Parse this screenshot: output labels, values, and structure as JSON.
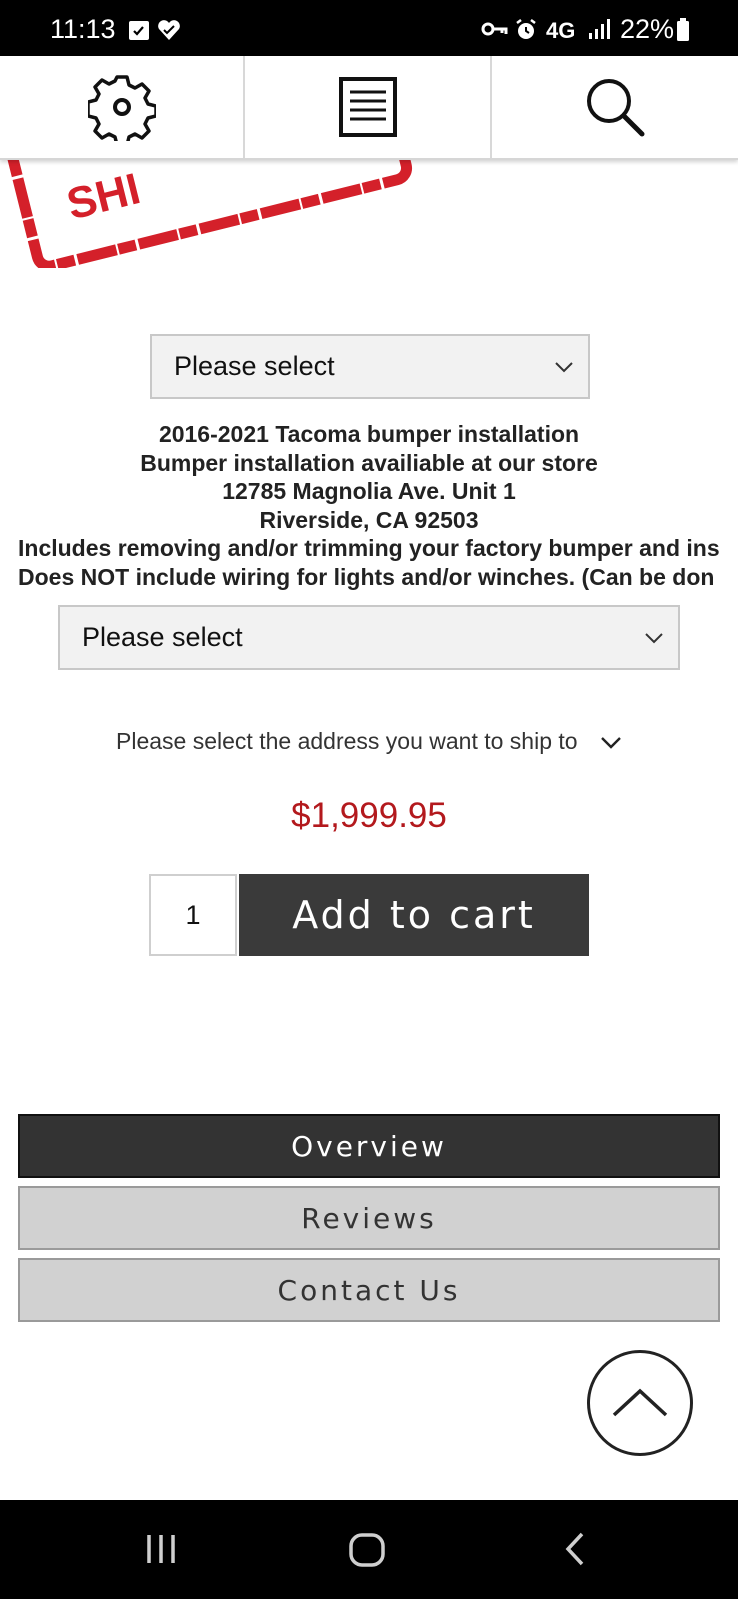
{
  "status_bar": {
    "time": "11:13",
    "network": "4G",
    "battery": "22%"
  },
  "top_nav": {
    "settings_icon": "gear-icon",
    "menu_icon": "document-list-icon",
    "search_icon": "search-icon"
  },
  "stamp": {
    "text": "SHI"
  },
  "option_select_1": {
    "value": "Please select"
  },
  "description": {
    "line1": "2016-2021 Tacoma bumper installation",
    "line2": "Bumper installation availiable at our store",
    "line3": "12785 Magnolia Ave. Unit 1",
    "line4": "Riverside, CA 92503",
    "line5": "Includes removing and/or trimming your factory bumper and ins",
    "line6": "Does NOT include wiring for lights and/or winches. (Can be don"
  },
  "option_select_2": {
    "value": "Please select"
  },
  "shipping": {
    "label": "Please select the address you want to ship to"
  },
  "price": "$1,999.95",
  "cart": {
    "quantity": "1",
    "add_label": "Add to cart"
  },
  "tabs": [
    {
      "label": "Overview"
    },
    {
      "label": "Reviews"
    },
    {
      "label": "Contact Us"
    }
  ],
  "colors": {
    "price": "#b3191d",
    "dark_button": "#3a3a3a",
    "stamp_red": "#d4202a"
  }
}
